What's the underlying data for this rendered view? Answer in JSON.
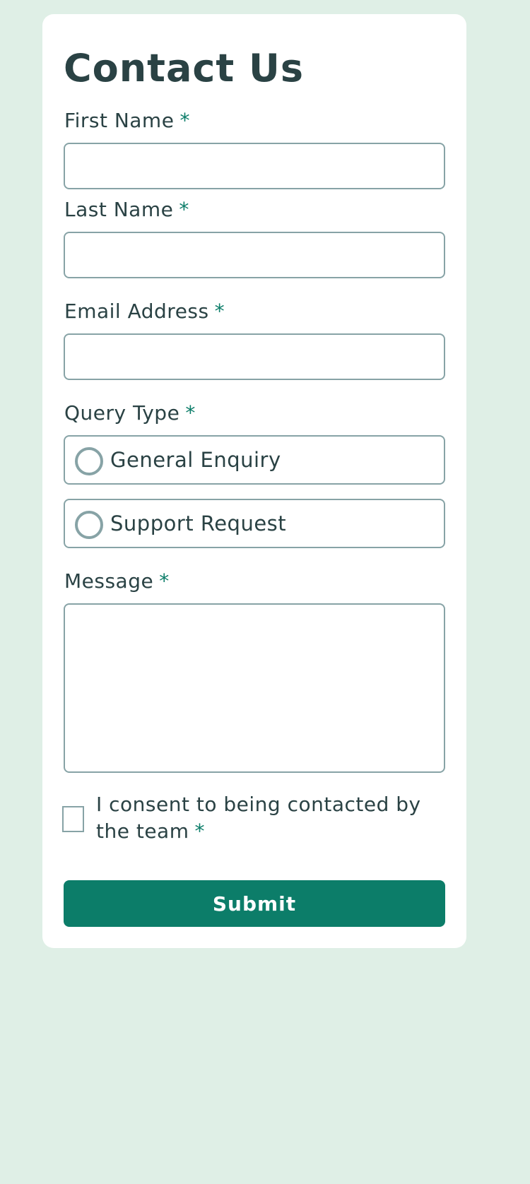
{
  "form": {
    "title": "Contact Us",
    "required_marker": "*",
    "first_name": {
      "label": "First Name",
      "value": ""
    },
    "last_name": {
      "label": "Last Name",
      "value": ""
    },
    "email": {
      "label": "Email Address",
      "value": ""
    },
    "query_type": {
      "label": "Query Type",
      "options": [
        {
          "label": "General Enquiry",
          "selected": false
        },
        {
          "label": "Support Request",
          "selected": false
        }
      ]
    },
    "message": {
      "label": "Message",
      "value": ""
    },
    "consent": {
      "label": "I consent to being contacted by the team",
      "checked": false
    },
    "submit_label": "Submit"
  },
  "colors": {
    "background": "#dfefe6",
    "card": "#ffffff",
    "text": "#2a4244",
    "accent": "#0c7d69",
    "border": "#87a3a6"
  }
}
